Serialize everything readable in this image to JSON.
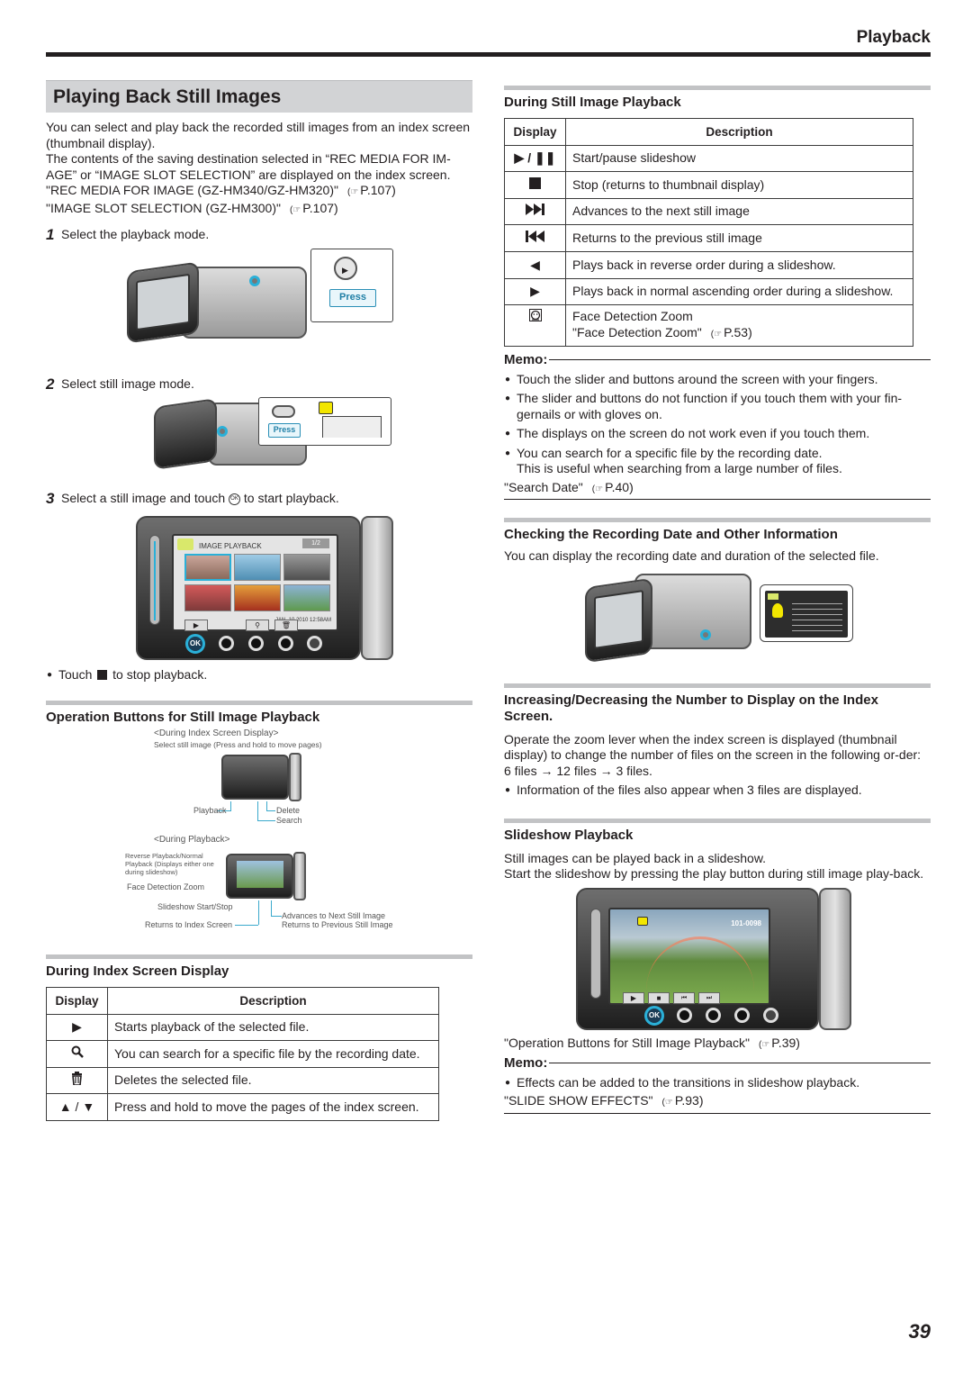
{
  "header": {
    "section": "Playback"
  },
  "page_number": "39",
  "ref_icon": "pointing-hand-icon",
  "left": {
    "title": "Playing Back Still Images",
    "intro": [
      "You can select and play back the recorded still images from an index screen (thumbnail display).",
      "The contents of the saving destination selected in “REC MEDIA FOR IM-AGE” or “IMAGE SLOT SELECTION” are displayed on the index screen."
    ],
    "refs": [
      {
        "text": "\"REC MEDIA FOR IMAGE (GZ-HM340/GZ-HM320)\"",
        "page": "P.107"
      },
      {
        "text": "\"IMAGE SLOT SELECTION (GZ-HM300)\"",
        "page": "P.107"
      }
    ],
    "steps": [
      {
        "num": "1",
        "text": "Select the playback mode."
      },
      {
        "num": "2",
        "text": "Select still image mode."
      },
      {
        "num": "3",
        "text_before": "Select a still image and touch",
        "ok_icon": "OK",
        "text_after": "to start playback."
      }
    ],
    "illus_step1": {
      "press_label": "Press"
    },
    "illus_step2": {
      "press_label": "Press"
    },
    "illus_step3": {
      "screen_title": "IMAGE PLAYBACK",
      "page_indicator": "1/2",
      "date_time": "JAN. 10.2010 12:58AM",
      "ok_label": "OK"
    },
    "stop_note": {
      "before": "Touch",
      "after": "to stop playback."
    },
    "op_buttons": {
      "title": "Operation Buttons for Still Image Playback",
      "index_caption": "<During Index Screen Display>",
      "index_hint": "Select still image (Press and hold to move pages)",
      "index_labels": {
        "playback": "Playback",
        "delete": "Delete",
        "search": "Search"
      },
      "playback_caption": "<During Playback>",
      "playback_labels": {
        "reverse_normal": "Reverse Playback/Normal Playback (Displays either one during slideshow)",
        "face_zoom": "Face Detection Zoom",
        "slideshow": "Slideshow Start/Stop",
        "return_index": "Returns to Index Screen",
        "next_image": "Advances to Next Still Image",
        "prev_image": "Returns to Previous Still Image"
      }
    },
    "index_display": {
      "title": "During Index Screen Display",
      "columns": [
        "Display",
        "Description"
      ],
      "rows": [
        {
          "icon": "play-icon",
          "glyph": "▶",
          "description": "Starts playback of the selected file."
        },
        {
          "icon": "search-icon",
          "glyph": "🔍",
          "description": "You can search for a specific file by the recording date."
        },
        {
          "icon": "trash-icon",
          "glyph": "🗑",
          "description": "Deletes the selected file."
        },
        {
          "icon": "page-up-down-icon",
          "glyph": "▲ / ▼",
          "description": "Press and hold to move the pages of the index screen."
        }
      ]
    }
  },
  "right": {
    "still_playback": {
      "title": "During Still Image Playback",
      "columns": [
        "Display",
        "Description"
      ],
      "rows": [
        {
          "icon": "play-pause-icon",
          "glyph": "▶ / ❚❚",
          "description": "Start/pause slideshow"
        },
        {
          "icon": "stop-icon",
          "glyph": "■",
          "description": "Stop (returns to thumbnail display)"
        },
        {
          "icon": "next-track-icon",
          "glyph": "▶▶▌",
          "description": "Advances to the next still image"
        },
        {
          "icon": "previous-track-icon",
          "glyph": "▐◀◀",
          "description": "Returns to the previous still image"
        },
        {
          "icon": "reverse-play-icon",
          "glyph": "◀",
          "description": "Plays back in reverse order during a slideshow."
        },
        {
          "icon": "play-icon",
          "glyph": "▶",
          "description": "Plays back in normal ascending order during a slideshow."
        },
        {
          "icon": "face-detection-icon",
          "glyph": "☺",
          "description": "Face Detection Zoom",
          "ref_text": "\"Face Detection Zoom\"",
          "ref_page": "P.53"
        }
      ]
    },
    "memo1": {
      "label": "Memo:",
      "bullets": [
        "Touch the slider and buttons around the screen with your fingers.",
        "The slider and buttons do not function if you touch them with your fin-gernails or with gloves on.",
        "The displays on the screen do not work even if you touch them.",
        "You can search for a specific file by the recording date.\nThis is useful when searching from a large number of files."
      ],
      "ref_text": "\"Search Date\"",
      "ref_page": "P.40"
    },
    "recording_info": {
      "title": "Checking the Recording Date and Other Information",
      "body": "You can display the recording date and duration of the selected file."
    },
    "index_number": {
      "title": "Increasing/Decreasing the Number to Display on the Index Screen.",
      "body": "Operate the zoom lever when the index screen is displayed (thumbnail display) to change the number of files on the screen in the following or-der: 6 files → 12 files → 3 files.",
      "bullet": "Information of the files also appear when 3 files are displayed."
    },
    "slideshow": {
      "title": "Slideshow Playback",
      "body": [
        "Still images can be played back in a slideshow.",
        "Start the slideshow by pressing the play button during still image play-back."
      ],
      "screen_file_no": "101-0098",
      "ok_label": "OK",
      "ref_text": "\"Operation Buttons for Still Image Playback\"",
      "ref_page": "P.39"
    },
    "memo2": {
      "label": "Memo:",
      "bullets": [
        "Effects can be added to the transitions in slideshow playback."
      ],
      "ref_text": "\"SLIDE SHOW EFFECTS\"",
      "ref_page": "P.93"
    }
  },
  "colors": {
    "accent_blue": "#2ab0d8",
    "section_bar": "#c2c3c5",
    "title_bar": "#d2d3d5",
    "text": "#231f20"
  }
}
